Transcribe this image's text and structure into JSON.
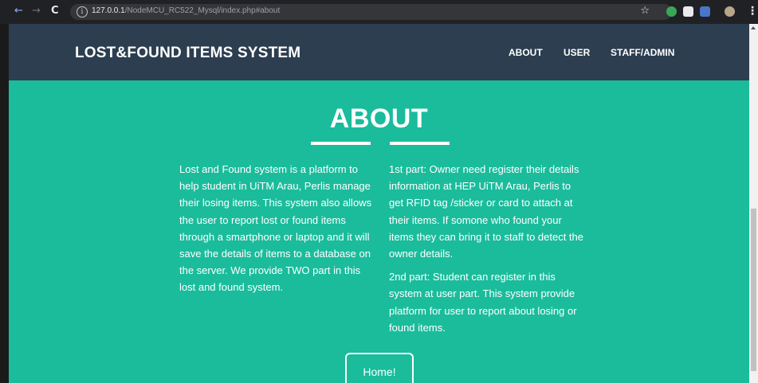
{
  "browser": {
    "url_host": "127.0.0.1",
    "url_path": "/NodeMCU_RC522_Mysql/index.php#about",
    "colors": {
      "chrome": "#202124",
      "omnibox": "#35363a"
    }
  },
  "site": {
    "brand": "LOST&FOUND ITEMS SYSTEM",
    "nav": [
      "ABOUT",
      "USER",
      "STAFF/ADMIN"
    ],
    "colors": {
      "navbar": "#2c3e50",
      "accent": "#1abc9c",
      "text": "#ffffff"
    }
  },
  "about": {
    "title": "ABOUT",
    "left_paragraph": "Lost and Found system is a platform to help student in UiTM Arau, Perlis manage their losing items. This system also allows the user to report lost or found items through a smartphone or laptop and it will save the details of items to a database on the server. We provide TWO part in this lost and found system.",
    "right_paragraph_1": "1st part: Owner need register their details information at HEP UiTM Arau, Perlis to get RFID tag /sticker or card to attach at their items. If somone who found your items they can bring it to staff to detect the owner details.",
    "right_paragraph_2": "2nd part: Student can register in this system at user part. This system provide platform for user to report about losing or found items.",
    "button": "Home!"
  }
}
